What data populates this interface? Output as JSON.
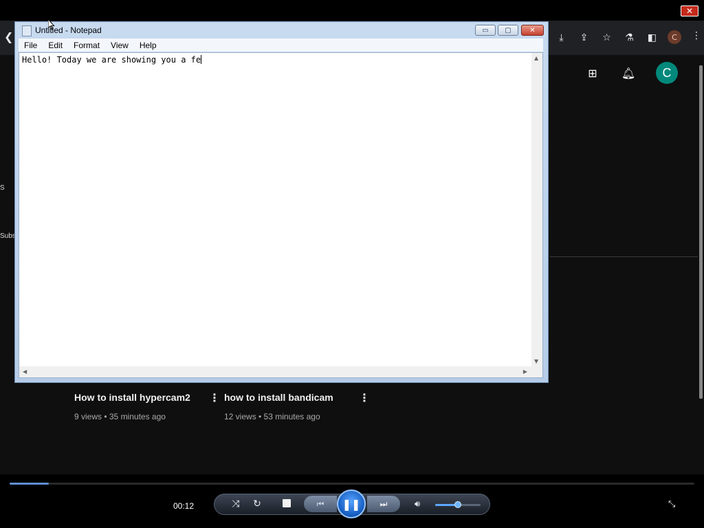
{
  "player": {
    "close_glyph": "✕",
    "time": "00:12",
    "progress_fraction": 0.057,
    "volume_fraction": 0.5,
    "controls": {
      "shuffle_icon": "shuffle-icon",
      "repeat_icon": "repeat-icon",
      "stop_icon": "stop-icon",
      "prev_icon": "previous-icon",
      "play_icon": "pause-icon",
      "next_icon": "next-icon",
      "volume_icon": "volume-icon"
    },
    "colors": {
      "accent": "#1e6fd9",
      "seek_fill": "#5f8fd0"
    }
  },
  "browser": {
    "avatar_letter": "C",
    "icons": [
      "download-icon",
      "share-icon",
      "star-icon",
      "labs-icon",
      "sidepanel-icon",
      "profile-avatar",
      "more-icon"
    ]
  },
  "youtube": {
    "avatar_letter": "C",
    "avatar_color": "#00897b",
    "side_labels": [
      "S",
      "Subs"
    ],
    "videos": [
      {
        "title": "How to install hypercam2",
        "meta": "9 views • 35 minutes ago"
      },
      {
        "title": "how to install bandicam",
        "meta": "12 views • 53 minutes ago"
      }
    ]
  },
  "notepad": {
    "title": "Untitled - Notepad",
    "menu": [
      "File",
      "Edit",
      "Format",
      "View",
      "Help"
    ],
    "content": "Hello! Today we are showing you a fe",
    "buttons": {
      "minimize": "▭",
      "maximize": "▢",
      "close": "✕"
    }
  }
}
